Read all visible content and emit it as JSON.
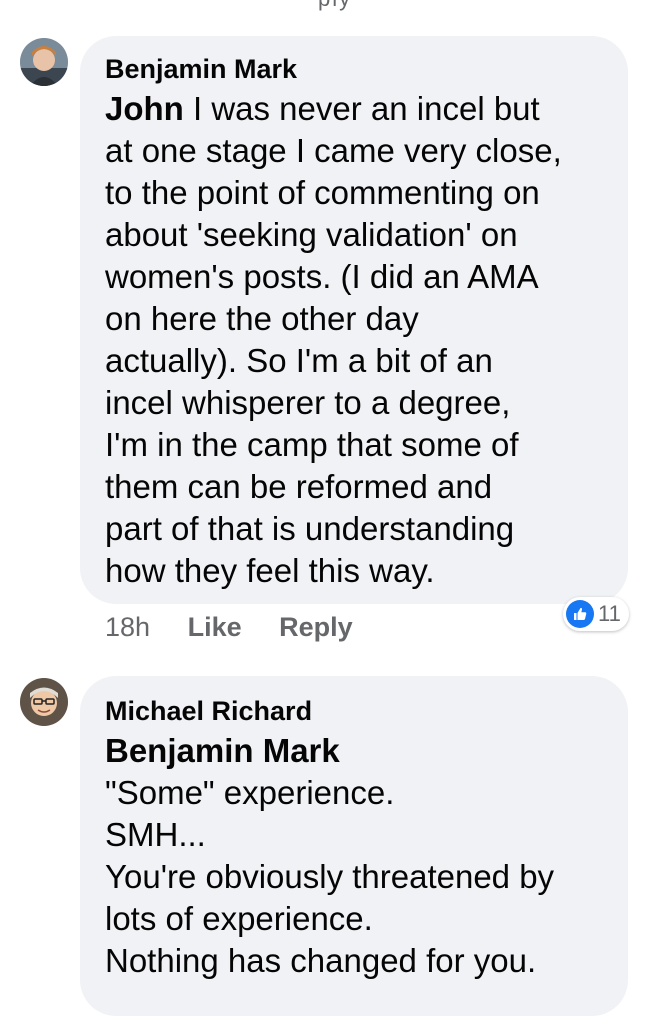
{
  "top_fragment": "ply",
  "comments": [
    {
      "author": "Benjamin Mark",
      "mention": "John",
      "lines": [
        " I was never an incel but",
        "at one stage I came very close,",
        "to the point of commenting on",
        "about 'seeking validation' on",
        "women's posts. (I did an AMA",
        "on here the other day",
        "actually). So I'm a bit of an",
        "incel whisperer to a degree,",
        "I'm in the camp that some of",
        "them can be reformed and",
        "part of that is understanding",
        "how they feel this way."
      ],
      "time": "18h",
      "like_label": "Like",
      "reply_label": "Reply",
      "reaction_count": "11",
      "reaction_icon": "thumbs-up-icon",
      "reaction_color": "#1877f2"
    },
    {
      "author": "Michael Richard",
      "mention": "Benjamin Mark",
      "lines": [
        "\"Some\" experience.",
        "SMH...",
        "You're obviously threatened by",
        "lots of experience.",
        "Nothing has changed for you."
      ]
    }
  ],
  "colors": {
    "bubble": "#f0f2f5",
    "secondary_text": "#65676b",
    "primary_text": "#050505"
  }
}
